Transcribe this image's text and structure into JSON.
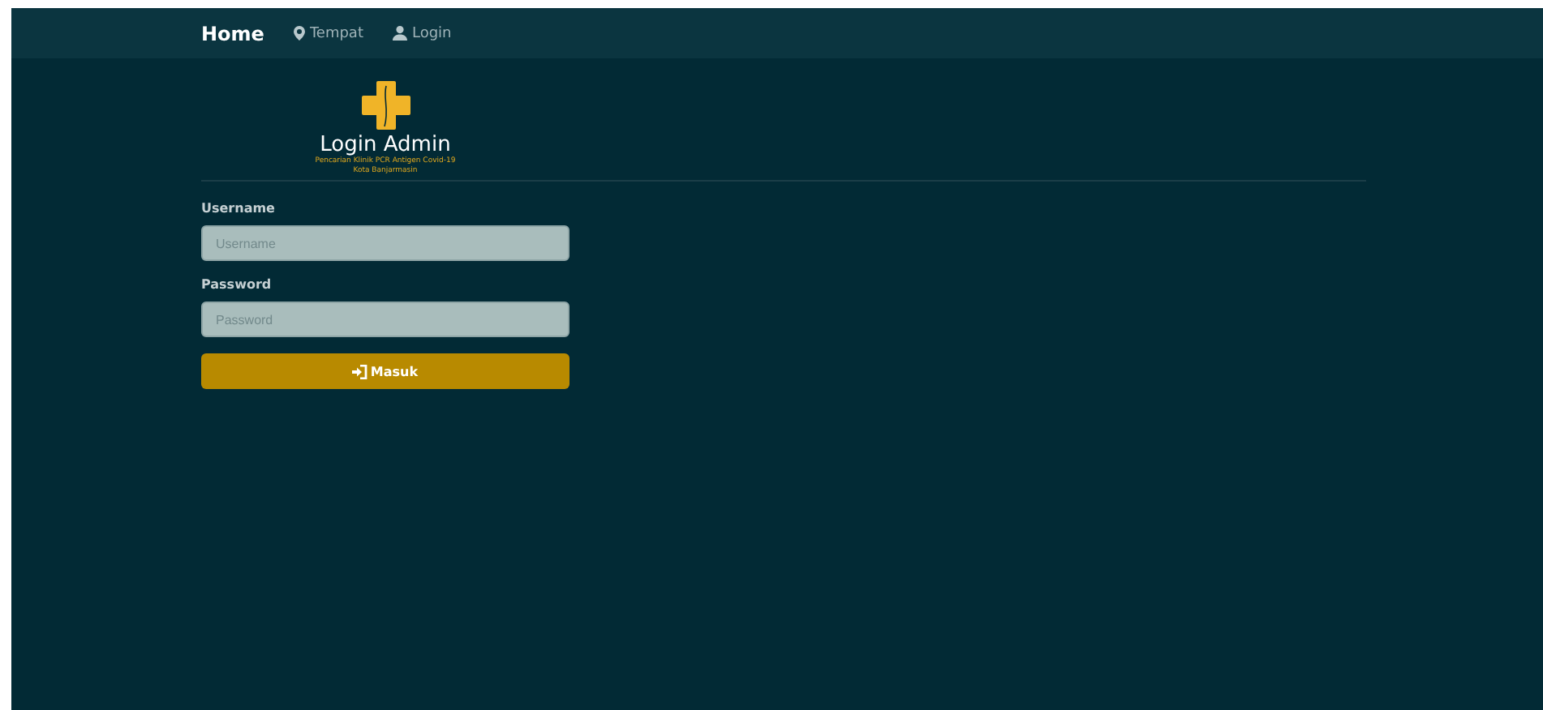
{
  "navbar": {
    "items": [
      {
        "label": "Home",
        "kind": "plain",
        "selected": true
      },
      {
        "label": "Tempat",
        "kind": "place",
        "selected": false
      },
      {
        "label": "Login",
        "kind": "account",
        "selected": false
      }
    ]
  },
  "header": {
    "title": "Login Admin",
    "subtitle_lines": [
      "Pencarian Klinik PCR Antigen Covid-19",
      "Kota Banjarmasin"
    ]
  },
  "form": {
    "fields": [
      {
        "label": "Username",
        "placeholder": "Username"
      },
      {
        "label": "Password",
        "placeholder": "Password"
      }
    ],
    "submit": "Masuk"
  }
}
